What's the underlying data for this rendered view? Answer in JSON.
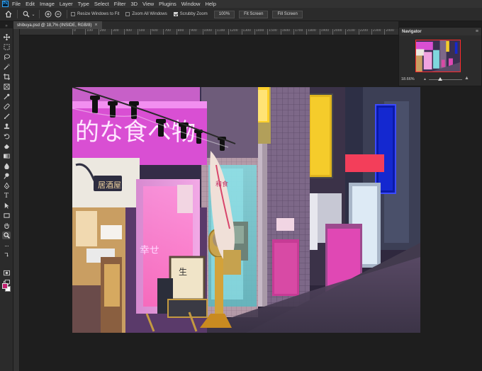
{
  "app": {
    "logo": "Ps"
  },
  "menu": [
    "File",
    "Edit",
    "Image",
    "Layer",
    "Type",
    "Select",
    "Filter",
    "3D",
    "View",
    "Plugins",
    "Window",
    "Help"
  ],
  "options": {
    "home_icon": "home-icon",
    "zoom_tool_icon": "zoom-icon",
    "zoom_in_icon": "zoom-in-icon",
    "zoom_out_icon": "zoom-out-icon",
    "resize_windows_label": "Resize Windows to Fit",
    "resize_windows_checked": false,
    "zoom_all_windows_label": "Zoom All Windows",
    "zoom_all_windows_checked": false,
    "scrubby_zoom_label": "Scrubby Zoom",
    "scrubby_zoom_checked": true,
    "percent_button": "100%",
    "fit_screen_button": "Fit Screen",
    "fill_screen_button": "Fill Screen"
  },
  "document_tab": {
    "title": "shibuya.psd @ 18,7% (INSIDE, RGB/8)",
    "close": "×"
  },
  "ruler": {
    "ticks": [
      "0",
      "100",
      "200",
      "300",
      "400",
      "500",
      "600",
      "700",
      "800",
      "900",
      "1000",
      "1100",
      "1200",
      "1300",
      "1400",
      "1500",
      "1600",
      "1700",
      "1800",
      "1900",
      "2000",
      "2100",
      "2200",
      "2300",
      "2400",
      "2500",
      "2600",
      "2700",
      "2800",
      "2900"
    ]
  },
  "tools": [
    "move-tool-icon",
    "marquee-tool-icon",
    "lasso-tool-icon",
    "magic-wand-icon",
    "crop-tool-icon",
    "frame-tool-icon",
    "eyedropper-icon",
    "healing-brush-icon",
    "brush-tool-icon",
    "clone-stamp-icon",
    "history-brush-icon",
    "eraser-icon",
    "gradient-tool-icon",
    "blur-tool-icon",
    "dodge-tool-icon",
    "pen-tool-icon",
    "type-tool-icon",
    "path-selection-icon",
    "rectangle-tool-icon",
    "hand-tool-icon",
    "zoom-tool-icon",
    "more-tools-icon"
  ],
  "colors": {
    "foreground": "#c2206f",
    "background": "#ffffff",
    "ui_dark": "#1e1e1e",
    "panel": "#2b2b2b",
    "navigator_frame": "#ff2b2b"
  },
  "artwork": {
    "sign_text": "的な食べ物",
    "shop_sign_text": "幸せ",
    "banner_text": "居酒屋",
    "board_text": "生",
    "small_sign_text": "和食"
  },
  "navigator": {
    "title": "Navigator",
    "zoom": "18.66%",
    "zoom_fraction": 0.35
  }
}
